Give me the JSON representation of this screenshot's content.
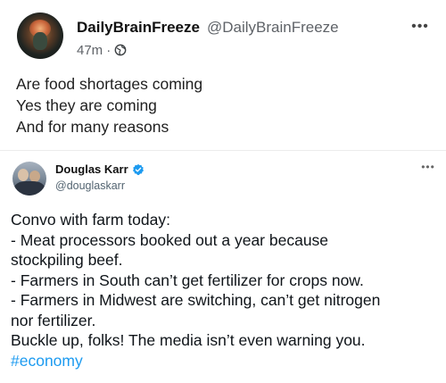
{
  "post": {
    "display_name": "DailyBrainFreeze",
    "handle": "@DailyBrainFreeze",
    "time": "47m",
    "dot": "·",
    "visibility_icon": "globe-icon",
    "more_label": "•••",
    "text_lines": [
      "Are food shortages coming",
      "Yes they are coming",
      "And for many reasons"
    ]
  },
  "embedded_tweet": {
    "author": "Douglas Karr",
    "verified_icon": "verified-badge-icon",
    "handle": "@douglaskarr",
    "more_label": "•••",
    "lines": [
      "Convo with farm today:",
      "- Meat processors booked out a year because",
      "stockpiling beef.",
      "- Farmers in South can’t get fertilizer for crops now.",
      "- Farmers in Midwest are switching, can’t get nitrogen",
      "nor fertilizer.",
      "Buckle up, folks! The media isn’t even warning you."
    ],
    "hashtag": "#economy"
  },
  "colors": {
    "link": "#1d9bf0",
    "verified": "#1d9bf0",
    "secondary_text": "#5f6368"
  }
}
